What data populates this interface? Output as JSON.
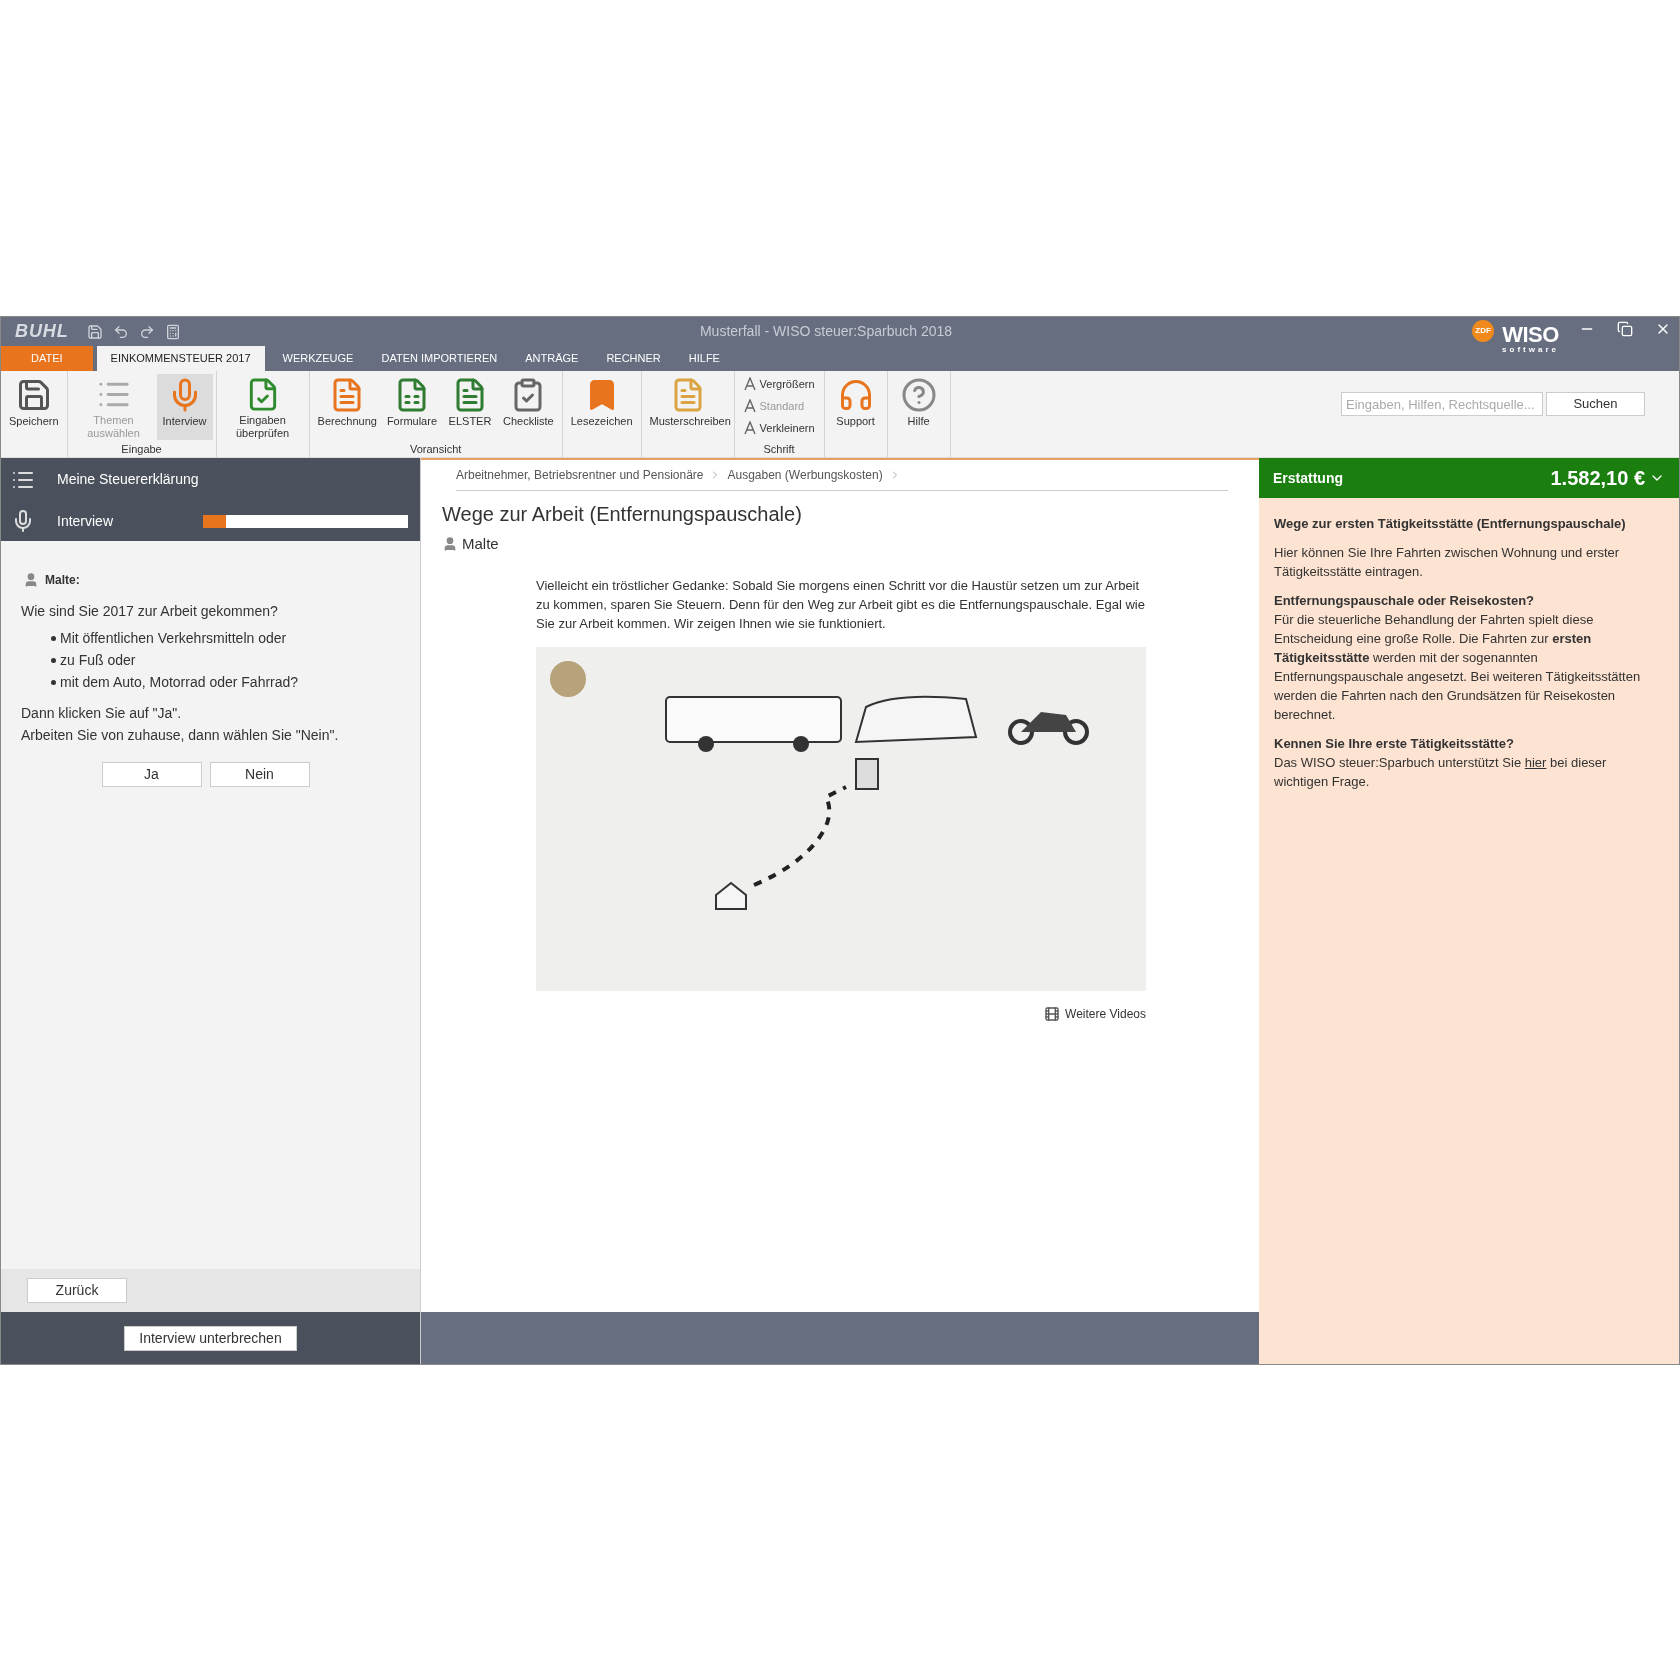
{
  "window": {
    "title": "Musterfall - WISO steuer:Sparbuch 2018",
    "brand": "BUHL",
    "logo": {
      "badge": "ZDF",
      "name": "WISO",
      "sub": "software"
    }
  },
  "menu_tabs": [
    {
      "label": "DATEI",
      "kind": "file",
      "selected": false
    },
    {
      "label": "EINKOMMENSTEUER 2017",
      "kind": "tab",
      "selected": true
    },
    {
      "label": "WERKZEUGE",
      "kind": "tab",
      "selected": false
    },
    {
      "label": "DATEN IMPORTIEREN",
      "kind": "tab",
      "selected": false
    },
    {
      "label": "ANTRÄGE",
      "kind": "tab",
      "selected": false
    },
    {
      "label": "RECHNER",
      "kind": "tab",
      "selected": false
    },
    {
      "label": "HILFE",
      "kind": "tab",
      "selected": false
    }
  ],
  "ribbon_groups": [
    {
      "items": [
        {
          "label": "Speichern",
          "kind": "save",
          "disabled": false,
          "selected": false
        }
      ]
    },
    {
      "label": "Eingabe",
      "items": [
        {
          "label": "Themen auswählen",
          "kind": "list",
          "disabled": true,
          "selected": false
        },
        {
          "label": "Interview",
          "kind": "mic",
          "disabled": false,
          "selected": true
        }
      ]
    },
    {
      "items": [
        {
          "label": "Eingaben überprüfen",
          "kind": "check",
          "disabled": false,
          "selected": false
        }
      ]
    },
    {
      "label": "Voransicht",
      "items": [
        {
          "label": "Berechnung",
          "kind": "calc",
          "disabled": false,
          "selected": false
        },
        {
          "label": "Formulare",
          "kind": "form",
          "disabled": false,
          "selected": false
        },
        {
          "label": "ELSTER",
          "kind": "elster",
          "disabled": false,
          "selected": false
        },
        {
          "label": "Checkliste",
          "kind": "checklist",
          "disabled": false,
          "selected": false
        }
      ]
    },
    {
      "items": [
        {
          "label": "Lesezeichen",
          "kind": "bookmark",
          "disabled": false,
          "selected": false
        }
      ]
    },
    {
      "items": [
        {
          "label": "Musterschreiben",
          "kind": "letter",
          "disabled": false,
          "selected": false
        }
      ]
    },
    {
      "label": "Schrift",
      "small_items": [
        {
          "label": "Vergrößern",
          "disabled": false
        },
        {
          "label": "Standard",
          "disabled": true
        },
        {
          "label": "Verkleinern",
          "disabled": false
        }
      ]
    },
    {
      "items": [
        {
          "label": "Support",
          "kind": "support",
          "disabled": false,
          "selected": false
        }
      ]
    },
    {
      "items": [
        {
          "label": "Hilfe",
          "kind": "help",
          "disabled": false,
          "selected": false
        }
      ]
    }
  ],
  "search": {
    "placeholder": "Eingaben, Hilfen, Rechtsquelle...",
    "button": "Suchen"
  },
  "left_panel": {
    "nav": [
      {
        "label": "Meine Steuererklärung",
        "kind": "menu"
      },
      {
        "label": "Interview",
        "kind": "progress",
        "level": 0.11
      }
    ],
    "speaker": "Malte:",
    "question": "Wie sind Sie 2017 zur Arbeit gekommen?",
    "bullets": [
      "Mit öffentlichen Verkehrsmitteln oder",
      "zu Fuß oder",
      "mit dem Auto, Motorrad oder Fahrrad?"
    ],
    "hints": [
      "Dann klicken Sie auf \"Ja\".",
      "Arbeiten Sie von zuhause, dann wählen Sie \"Nein\"."
    ],
    "answers": [
      "Ja",
      "Nein"
    ],
    "back_button": "Zurück",
    "pause_button": "Interview unterbrechen"
  },
  "content": {
    "breadcrumb": [
      "Arbeitnehmer, Betriebsrentner und Pensionäre",
      "Ausgaben (Werbungskosten)"
    ],
    "title": "Wege zur Arbeit (Entfernungspauschale)",
    "author": "Malte",
    "intro": "Vielleicht ein tröstlicher Gedanke: Sobald Sie morgens einen Schritt vor die Haustür setzen um zur Arbeit zu kommen, sparen Sie Steuern. Denn für den Weg zur Arbeit gibt es die Entfernungspauschale. Egal wie Sie zur Arbeit kommen. Wir zeigen Ihnen wie sie funktioniert.",
    "video": {
      "kind": "picture"
    },
    "more_videos": "Weitere Videos"
  },
  "refund": {
    "label": "Erstattung",
    "amount": "1.582,10 €"
  },
  "help": {
    "title": "Wege zur ersten Tätigkeitsstätte (Entfernungspauschale)",
    "intro": "Hier können Sie Ihre Fahrten zwischen Wohnung und erster Tätigkeitsstätte eintragen.",
    "section_heading": "Entfernungspauschale oder Reisekosten?",
    "section_text": "Für die steuerliche Behandlung der Fahrten spielt diese Entscheidung eine große Rolle. Die Fahrten zur **ersten Tätigkeitsstätte** werden mit der sogenannten Entfernungspauschale angesetzt. Bei weiteren Tätigkeitsstätten werden die Fahrten nach den Grundsätzen für Reisekosten berechnet.",
    "question": "Kennen Sie Ihre erste Tätigkeitsstätte?",
    "answer_before": "Das WISO steuer:Sparbuch unterstützt Sie",
    "answer_link": "hier",
    "answer_after": "bei dieser wichtigen Frage."
  }
}
